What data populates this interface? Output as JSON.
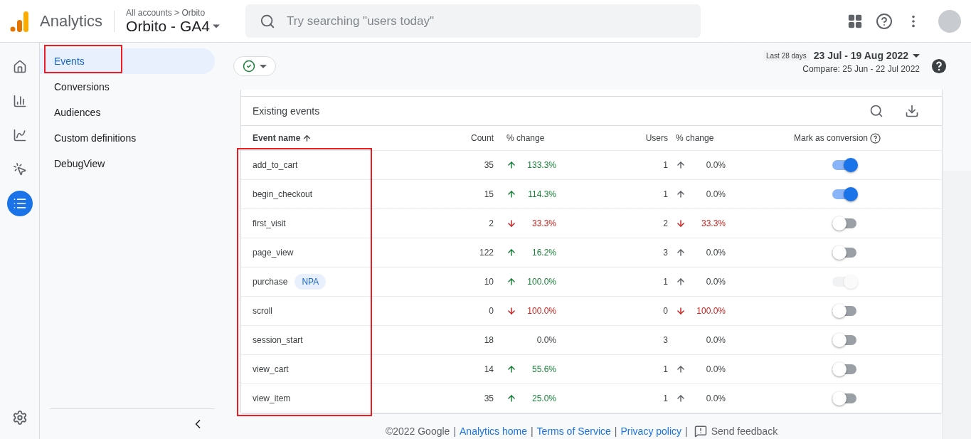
{
  "header": {
    "product": "Analytics",
    "breadcrumb": "All accounts > Orbito",
    "property": "Orbito - GA4",
    "search": {
      "placeholder": "Try searching \"users today\""
    }
  },
  "rail": [
    {
      "selected": false
    },
    {
      "selected": false
    },
    {
      "selected": false
    },
    {
      "selected": false
    },
    {
      "selected": true
    }
  ],
  "sidebar": {
    "items": [
      {
        "label": "Events",
        "selected": true,
        "highlighted": true
      },
      {
        "label": "Conversions",
        "selected": false,
        "highlighted": false
      },
      {
        "label": "Audiences",
        "selected": false,
        "highlighted": false
      },
      {
        "label": "Custom definitions",
        "selected": false,
        "highlighted": false
      },
      {
        "label": "DebugView",
        "selected": false,
        "highlighted": false
      }
    ]
  },
  "toolbar": {
    "date_preset": "Last 28 days",
    "date_range": "23 Jul - 19 Aug 2022",
    "compare": "Compare: 25 Jun - 22 Jul 2022"
  },
  "table": {
    "title": "Existing events",
    "names_highlighted": true,
    "columns": [
      "Event name",
      "Count",
      "% change",
      "Users",
      "% change",
      "Mark as conversion"
    ],
    "rows": [
      {
        "name": "add_to_cart",
        "count": "35",
        "count_change": {
          "kind": "rise",
          "value": "133.3%"
        },
        "users": "1",
        "users_change": {
          "kind": "flat",
          "value": "0.0%"
        },
        "on": true,
        "disabled": false
      },
      {
        "name": "begin_checkout",
        "count": "15",
        "count_change": {
          "kind": "rise",
          "value": "114.3%"
        },
        "users": "1",
        "users_change": {
          "kind": "flat",
          "value": "0.0%"
        },
        "on": true,
        "disabled": false
      },
      {
        "name": "first_visit",
        "count": "2",
        "count_change": {
          "kind": "fall",
          "value": "33.3%"
        },
        "users": "2",
        "users_change": {
          "kind": "fall",
          "value": "33.3%"
        },
        "on": false,
        "disabled": false
      },
      {
        "name": "page_view",
        "count": "122",
        "count_change": {
          "kind": "rise",
          "value": "16.2%"
        },
        "users": "3",
        "users_change": {
          "kind": "flat",
          "value": "0.0%"
        },
        "on": false,
        "disabled": false
      },
      {
        "name": "purchase",
        "badge": "NPA",
        "count": "10",
        "count_change": {
          "kind": "rise",
          "value": "100.0%"
        },
        "users": "1",
        "users_change": {
          "kind": "flat",
          "value": "0.0%"
        },
        "on": true,
        "disabled": true
      },
      {
        "name": "scroll",
        "count": "0",
        "count_change": {
          "kind": "fall",
          "value": "100.0%"
        },
        "users": "0",
        "users_change": {
          "kind": "fall",
          "value": "100.0%"
        },
        "on": false,
        "disabled": false
      },
      {
        "name": "session_start",
        "count": "18",
        "count_change": {
          "kind": "none",
          "value": "0.0%"
        },
        "users": "3",
        "users_change": {
          "kind": "none",
          "value": "0.0%"
        },
        "on": false,
        "disabled": false
      },
      {
        "name": "view_cart",
        "count": "14",
        "count_change": {
          "kind": "rise",
          "value": "55.6%"
        },
        "users": "1",
        "users_change": {
          "kind": "flat",
          "value": "0.0%"
        },
        "on": false,
        "disabled": false
      },
      {
        "name": "view_item",
        "count": "35",
        "count_change": {
          "kind": "rise",
          "value": "25.0%"
        },
        "users": "1",
        "users_change": {
          "kind": "flat",
          "value": "0.0%"
        },
        "on": false,
        "disabled": false
      }
    ]
  },
  "footer": [
    {
      "kind": "text",
      "label": "©2022 Google"
    },
    {
      "kind": "sep",
      "label": "|"
    },
    {
      "kind": "link",
      "label": "Analytics home"
    },
    {
      "kind": "sep",
      "label": "|"
    },
    {
      "kind": "link",
      "label": "Terms of Service"
    },
    {
      "kind": "sep",
      "label": "|"
    },
    {
      "kind": "link",
      "label": "Privacy policy"
    },
    {
      "kind": "sep",
      "label": "|"
    },
    {
      "kind": "feedback",
      "label": "Send feedback"
    }
  ]
}
